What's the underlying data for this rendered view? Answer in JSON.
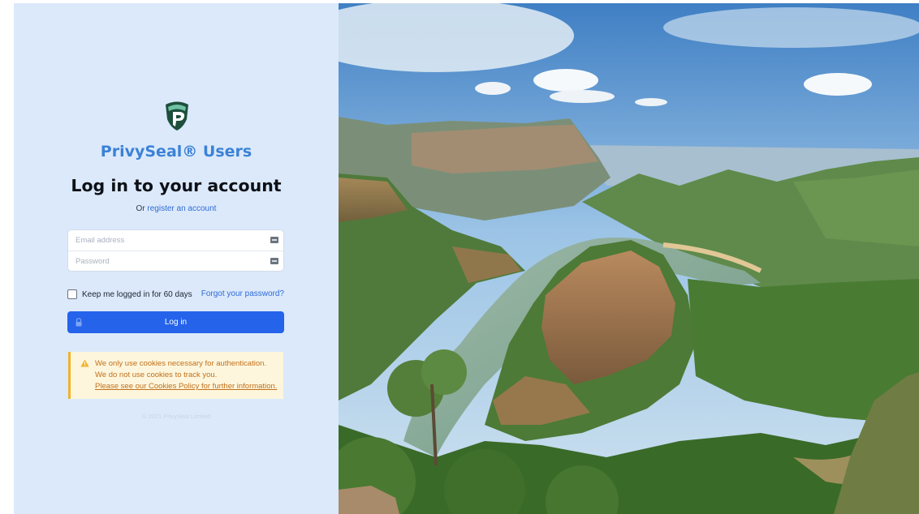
{
  "brand": {
    "name": "PrivySeal® Users"
  },
  "auth": {
    "heading": "Log in to your account",
    "register_prefix": "Or",
    "register_link": "register an account",
    "email_placeholder": "Email address",
    "password_placeholder": "Password",
    "remember_label": "Keep me logged in for 60 days",
    "forgot_link": "Forgot your password?",
    "login_button": "Log in"
  },
  "notice": {
    "line1": "We only use cookies necessary for authentication.",
    "line2": "We do not use cookies to track you.",
    "line3": "Please see our Cookies Policy for further information."
  },
  "footer": {
    "copyright": "© 2021 PrivySeal Limited"
  },
  "icons": {
    "logo": "privyseal-shield-logo",
    "email": "autofill-card-icon",
    "password": "autofill-card-icon",
    "lock": "lock-icon",
    "warning": "warning-icon"
  },
  "colors": {
    "panel_bg": "#dbe9fb",
    "brand": "#3b82d6",
    "button": "#2563eb",
    "link": "#2f6bd6",
    "notice_bg": "#fdf6dd",
    "notice_border": "#f2b22a",
    "notice_text": "#c2701a"
  }
}
